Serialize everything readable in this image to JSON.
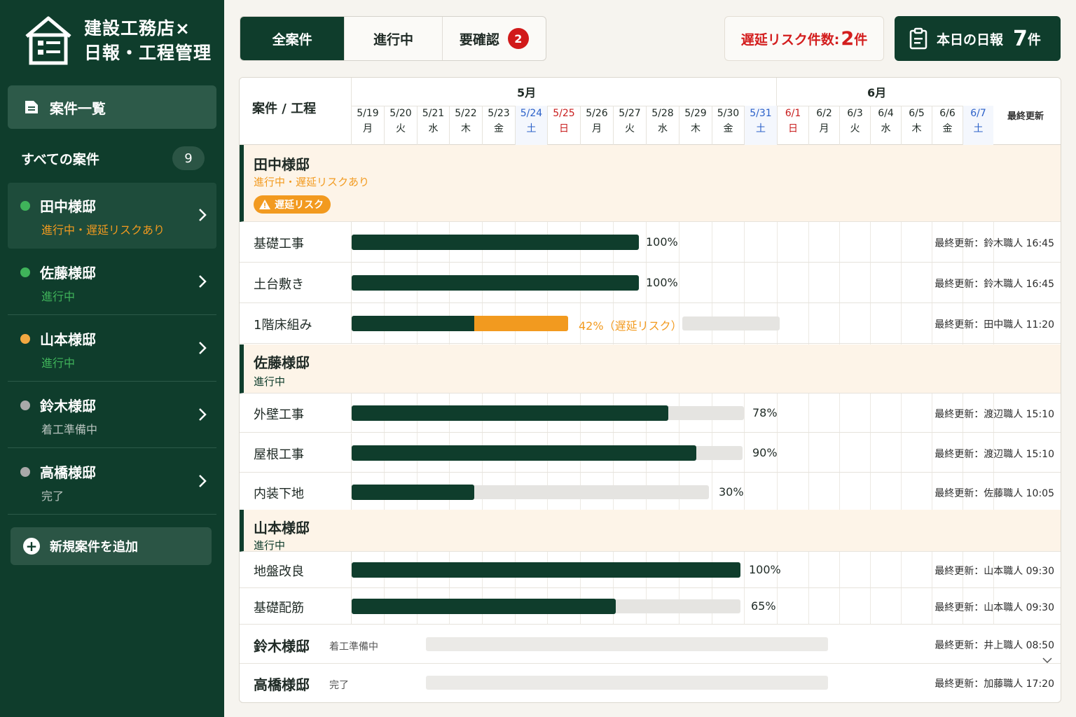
{
  "brand": {
    "line1": "建設工務店×",
    "line2": "日報・工程管理"
  },
  "nav": {
    "active_label": "案件一覧",
    "all_label": "すべての案件",
    "all_count": "9"
  },
  "projects": [
    {
      "name": "田中様邸",
      "status": "進行中・遅延リスクあり",
      "dot": "#3fb35a",
      "status_color": "#f29a1f"
    },
    {
      "name": "佐藤様邸",
      "status": "進行中",
      "dot": "#3fb35a",
      "status_color": "#3fb35a"
    },
    {
      "name": "山本様邸",
      "status": "進行中",
      "dot": "#f2a841",
      "status_color": "#3fb35a"
    },
    {
      "name": "鈴木様邸",
      "status": "着工準備中",
      "dot": "#a9a9a9",
      "status_color": "#b9c4bf"
    },
    {
      "name": "高橋様邸",
      "status": "完了",
      "dot": "#a9a9a9",
      "status_color": "#b9c4bf"
    }
  ],
  "add_button": "新規案件を追加",
  "tabs": [
    {
      "label": "全案件"
    },
    {
      "label": "進行中"
    },
    {
      "label": "要確認",
      "badge": "2"
    }
  ],
  "risk": {
    "label": "遅延リスク件数:",
    "count": "2",
    "unit": "件"
  },
  "today": {
    "label": "本日の日報",
    "count": "7",
    "unit": "件"
  },
  "gantt": {
    "header_label": "案件 / 工程",
    "months": [
      "5月",
      "6月"
    ],
    "last_update_header": "最終更新",
    "days": [
      {
        "date": "5/19",
        "dow": "月",
        "type": "weekday"
      },
      {
        "date": "5/20",
        "dow": "火",
        "type": "weekday"
      },
      {
        "date": "5/21",
        "dow": "水",
        "type": "weekday"
      },
      {
        "date": "5/22",
        "dow": "木",
        "type": "weekday"
      },
      {
        "date": "5/23",
        "dow": "金",
        "type": "weekday"
      },
      {
        "date": "5/24",
        "dow": "土",
        "type": "sat"
      },
      {
        "date": "5/25",
        "dow": "日",
        "type": "sun"
      },
      {
        "date": "5/26",
        "dow": "月",
        "type": "weekday"
      },
      {
        "date": "5/27",
        "dow": "火",
        "type": "weekday"
      },
      {
        "date": "5/28",
        "dow": "水",
        "type": "weekday"
      },
      {
        "date": "5/29",
        "dow": "木",
        "type": "weekday"
      },
      {
        "date": "5/30",
        "dow": "金",
        "type": "weekday"
      },
      {
        "date": "5/31",
        "dow": "土",
        "type": "sat"
      },
      {
        "date": "6/1",
        "dow": "日",
        "type": "sun"
      },
      {
        "date": "6/2",
        "dow": "月",
        "type": "weekday"
      },
      {
        "date": "6/3",
        "dow": "火",
        "type": "weekday"
      },
      {
        "date": "6/4",
        "dow": "水",
        "type": "weekday"
      },
      {
        "date": "6/5",
        "dow": "木",
        "type": "weekday"
      },
      {
        "date": "6/6",
        "dow": "金",
        "type": "weekday"
      },
      {
        "date": "6/7",
        "dow": "土",
        "type": "sat"
      }
    ],
    "groups": [
      {
        "name": "田中様邸",
        "status": "進行中・遅延リスクあり",
        "badge": "遅延リスク",
        "tasks": [
          {
            "name": "基礎工事",
            "progress": 100,
            "pct_text": "100%",
            "update": "最終更新：鈴木職人 16:45"
          },
          {
            "name": "土台敷き",
            "progress": 100,
            "pct_text": "100%",
            "update": "最終更新：鈴木職人 16:45"
          },
          {
            "name": "1階床組み",
            "progress": 42,
            "pct_text": "42%（遅延リスク）",
            "update": "最終更新：田中職人 11:20",
            "risk": true
          }
        ]
      },
      {
        "name": "佐藤様邸",
        "status": "進行中",
        "tasks": [
          {
            "name": "外壁工事",
            "progress": 78,
            "pct_text": "78%",
            "update": "最終更新：渡辺職人 15:10"
          },
          {
            "name": "屋根工事",
            "progress": 90,
            "pct_text": "90%",
            "update": "最終更新：渡辺職人 15:10"
          },
          {
            "name": "内装下地",
            "progress": 30,
            "pct_text": "30%",
            "update": "最終更新：佐藤職人 10:05"
          }
        ]
      },
      {
        "name": "山本様邸",
        "status": "進行中",
        "tasks": [
          {
            "name": "地盤改良",
            "progress": 100,
            "pct_text": "100%",
            "update": "最終更新：山本職人 09:30"
          },
          {
            "name": "基礎配筋",
            "progress": 65,
            "pct_text": "65%",
            "update": "最終更新：山本職人 09:30"
          }
        ]
      }
    ],
    "collapsed": [
      {
        "name": "鈴木様邸",
        "status": "着工準備中",
        "update": "最終更新：井上職人 08:50"
      },
      {
        "name": "高橋様邸",
        "status": "完了",
        "update": "最終更新：加藤職人 17:20"
      }
    ]
  }
}
